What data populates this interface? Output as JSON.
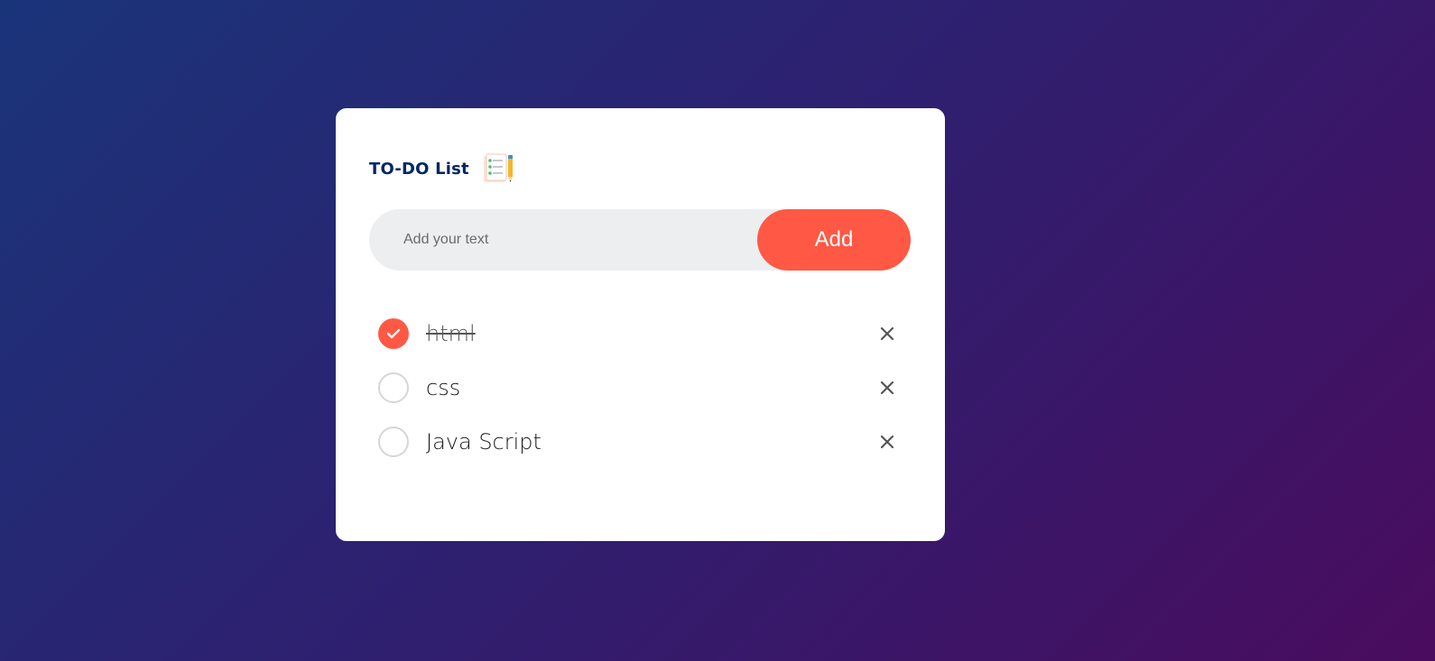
{
  "header": {
    "title": "TO-DO List",
    "icon": "checklist-notepad-pencil-icon"
  },
  "input": {
    "value": "",
    "placeholder": "Add your text"
  },
  "add_button": {
    "label": "Add"
  },
  "tasks": [
    {
      "text": "html",
      "checked": true
    },
    {
      "text": "css",
      "checked": false
    },
    {
      "text": "Java Script",
      "checked": false
    }
  ],
  "colors": {
    "accent": "#ff5945",
    "title": "#002765",
    "card": "#ffffff",
    "input_bg": "#edeef0"
  }
}
